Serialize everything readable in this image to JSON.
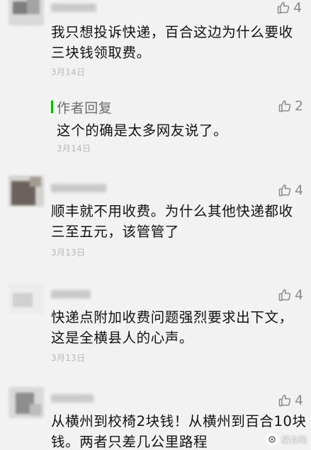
{
  "comments": [
    {
      "lines": [
        "我只想投诉快递，百合这边为什么要收",
        "三块钱领取费。"
      ],
      "date": "3月14日",
      "likes": "4",
      "reply": {
        "label": "作者回复",
        "likes": "2",
        "text": "这个的确是太多网友说了。",
        "date": "3月14日"
      }
    },
    {
      "lines": [
        "顺丰就不用收费。为什么其他快递都收",
        "三至五元，该管管了"
      ],
      "date": "3月13日",
      "likes": "4"
    },
    {
      "lines": [
        "快递点附加收费问题强烈要求出下文，",
        "这是全横县人的心声。"
      ],
      "date": "3月13日",
      "likes": "4"
    },
    {
      "lines": [
        "从横州到校椅2块钱！从横州到百合10块",
        "钱。两者只差几公里路程"
      ],
      "likes": "4"
    }
  ],
  "watermark": "横县网",
  "icons": {
    "like": "thumbs-up-icon",
    "watermark": "logo-icon"
  }
}
